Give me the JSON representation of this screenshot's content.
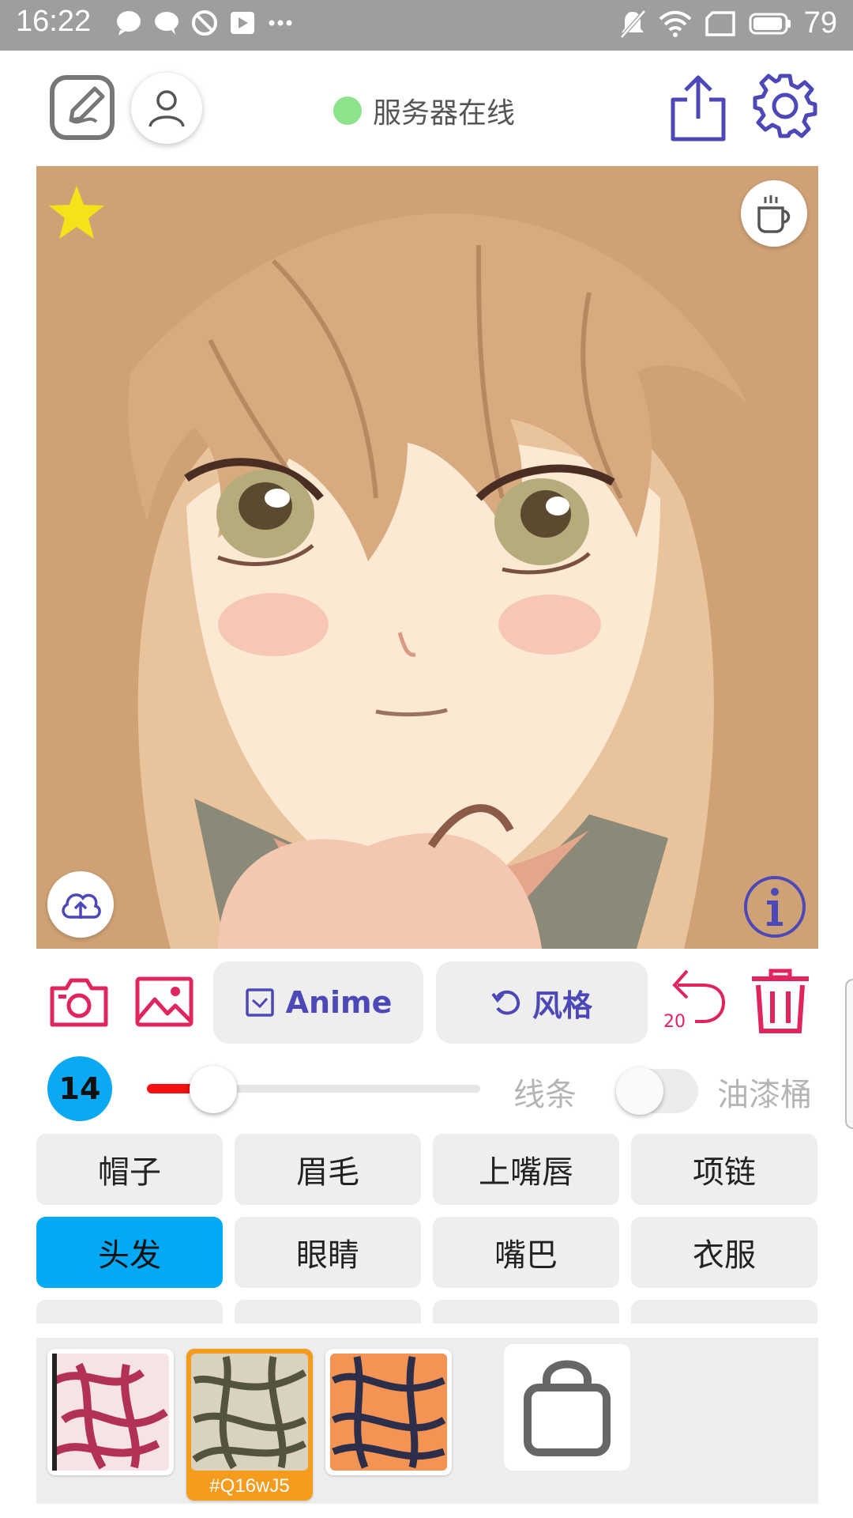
{
  "status_bar": {
    "time": "16:22",
    "battery": "79",
    "icons": [
      "chat-bubble-icon",
      "message-icon",
      "do-not-disturb-icon",
      "play-store-icon",
      "more-dots-icon",
      "mute-icon",
      "wifi-icon",
      "screen-rotation-icon",
      "battery-icon"
    ]
  },
  "header": {
    "server_status": "服务器在线",
    "status_color": "#8de38b",
    "icons": [
      "edit-icon",
      "user-icon",
      "share-icon",
      "settings-icon"
    ]
  },
  "canvas": {
    "icons": [
      "star-icon",
      "coffee-icon",
      "cloud-upload-icon",
      "info-icon"
    ]
  },
  "toolbar": {
    "model_label": "Anime",
    "style_label": "风格",
    "undo_count": "20",
    "icons": [
      "camera-icon",
      "image-icon",
      "checkbox-icon",
      "refresh-icon",
      "undo-icon",
      "trash-icon"
    ]
  },
  "brush": {
    "size": "14",
    "level": 0.2,
    "lines_label": "线条",
    "bucket_label": "油漆桶",
    "bucket_on": false
  },
  "parts": {
    "row1": [
      "帽子",
      "眉毛",
      "上嘴唇",
      "项链"
    ],
    "row2": [
      "头发",
      "眼睛",
      "嘴巴",
      "衣服"
    ],
    "selected": "头发"
  },
  "styles": {
    "selected_code": "#Q16wJ5"
  },
  "colors": {
    "accent": "#4c48b8",
    "danger": "#e0245e",
    "selected": "#03a9f4",
    "highlight": "#f59b1e"
  }
}
